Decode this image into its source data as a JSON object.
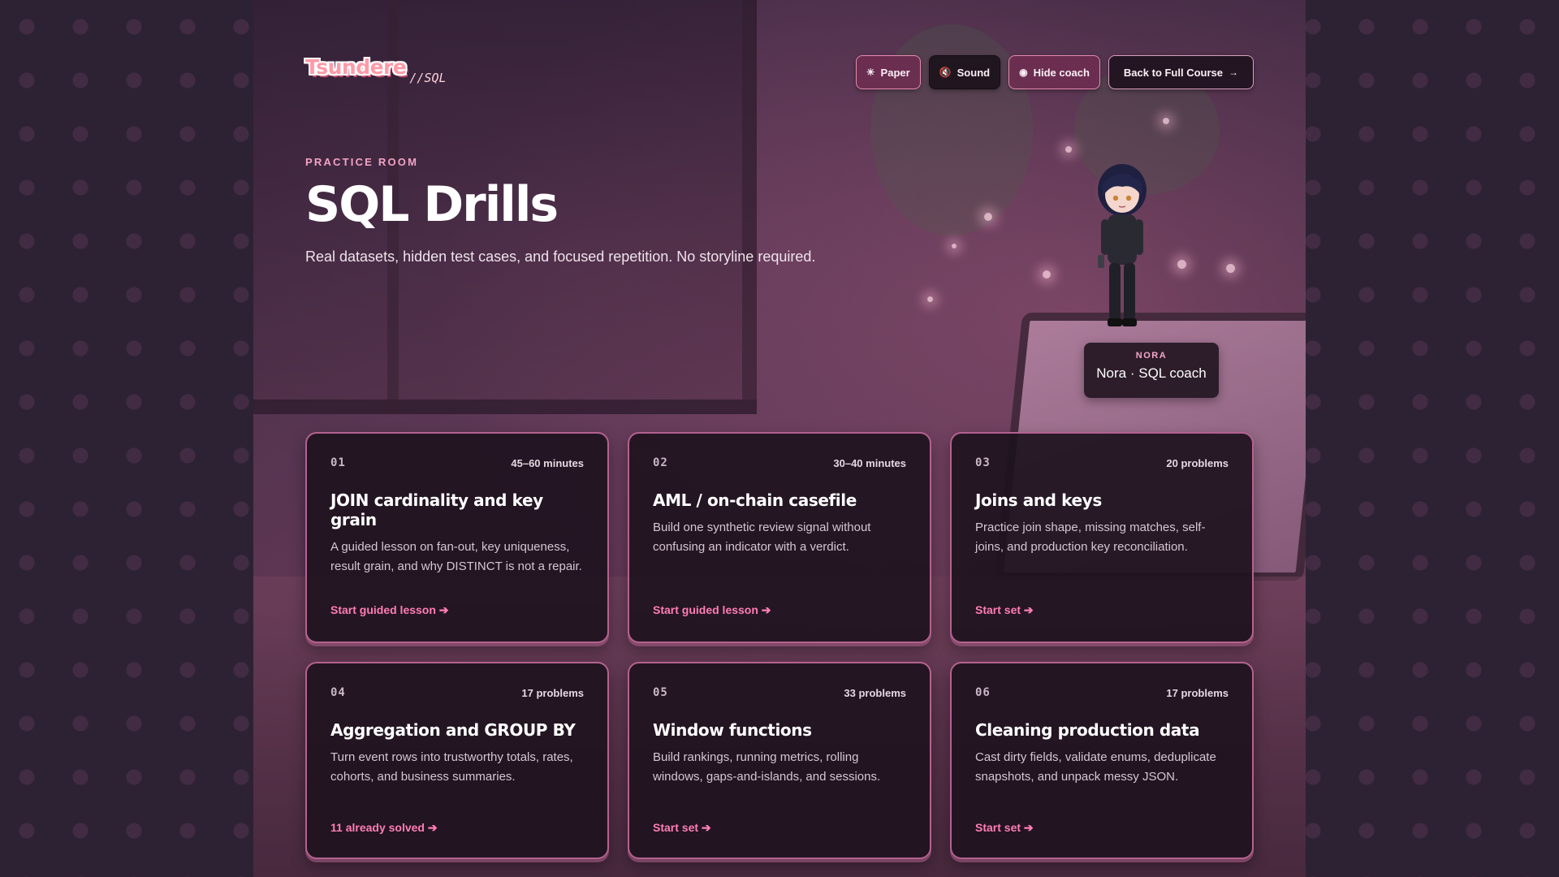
{
  "logo": {
    "main": "Tsundere",
    "sub": "//SQL"
  },
  "controls": {
    "paper": {
      "icon": "☀",
      "label": "Paper"
    },
    "sound": {
      "icon": "🔇",
      "label": "Sound"
    },
    "coach": {
      "icon": "◉",
      "label": "Hide coach"
    },
    "back": {
      "label": "Back to Full Course",
      "icon": "→"
    }
  },
  "hero": {
    "eyebrow": "PRACTICE ROOM",
    "title": "SQL Drills",
    "subtitle": "Real datasets, hidden test cases, and focused repetition. No storyline required."
  },
  "coach": {
    "label": "NORA",
    "name": "Nora · SQL coach"
  },
  "cards": [
    {
      "num": "01",
      "meta": "45–60 minutes",
      "title": "JOIN cardinality and key grain",
      "desc": "A guided lesson on fan-out, key uniqueness, result grain, and why DISTINCT is not a repair.",
      "link": "Start guided lesson ➔"
    },
    {
      "num": "02",
      "meta": "30–40 minutes",
      "title": "AML / on-chain casefile",
      "desc": "Build one synthetic review signal without confusing an indicator with a verdict.",
      "link": "Start guided lesson ➔"
    },
    {
      "num": "03",
      "meta": "20 problems",
      "title": "Joins and keys",
      "desc": "Practice join shape, missing matches, self-joins, and production key reconciliation.",
      "link": "Start set ➔"
    },
    {
      "num": "04",
      "meta": "17 problems",
      "title": "Aggregation and GROUP BY",
      "desc": "Turn event rows into trustworthy totals, rates, cohorts, and business summaries.",
      "link": "11 already solved ➔"
    },
    {
      "num": "05",
      "meta": "33 problems",
      "title": "Window functions",
      "desc": "Build rankings, running metrics, rolling windows, gaps-and-islands, and sessions.",
      "link": "Start set ➔"
    },
    {
      "num": "06",
      "meta": "17 problems",
      "title": "Cleaning production data",
      "desc": "Cast dirty fields, validate enums, deduplicate snapshots, and unpack messy JSON.",
      "link": "Start set ➔"
    }
  ]
}
